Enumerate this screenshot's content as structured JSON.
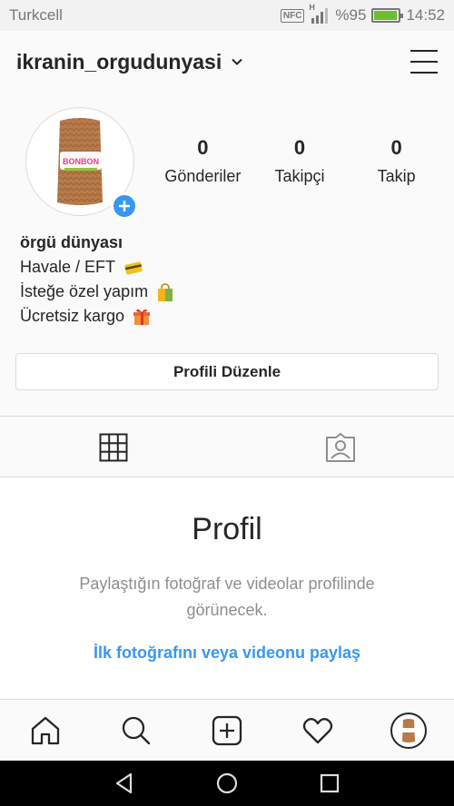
{
  "status_bar": {
    "carrier": "Turkcell",
    "nfc": "NFC",
    "network_type": "H",
    "battery": "%95",
    "battery_level": 0.95,
    "time": "14:52"
  },
  "header": {
    "username": "ikranin_orgudunyasi",
    "icons": [
      "chevron-down-icon",
      "menu-icon"
    ]
  },
  "profile": {
    "avatar_brand_text": "BONBON",
    "stats": [
      {
        "value": "0",
        "label": "Gönderiler"
      },
      {
        "value": "0",
        "label": "Takipçi"
      },
      {
        "value": "0",
        "label": "Takip"
      }
    ],
    "bio": {
      "name": "örgü dünyası",
      "lines": [
        "Havale / EFT",
        "İsteğe özel yapım",
        "Ücretsiz kargo"
      ],
      "line_icons": [
        "credit-card-icon",
        "shopping-bag-icon",
        "gift-icon"
      ]
    },
    "edit_button": "Profili Düzenle"
  },
  "tabs": [
    {
      "name": "grid",
      "icon": "grid-icon",
      "active": true
    },
    {
      "name": "tagged",
      "icon": "tagged-photos-icon",
      "active": false
    }
  ],
  "empty_state": {
    "title": "Profil",
    "text": "Paylaştığın fotoğraf ve videolar profilinde görünecek.",
    "link": "İlk fotoğrafını veya videonu paylaş"
  },
  "bottom_nav": [
    "home-icon",
    "search-icon",
    "add-post-icon",
    "activity-heart-icon",
    "profile-avatar-icon"
  ],
  "android_nav": [
    "back-icon",
    "home-circle-icon",
    "recents-icon"
  ],
  "colors": {
    "accent": "#3897f0",
    "text": "#262626",
    "muted": "#8e8e8e",
    "border": "#dbdbdb",
    "yarn": "#b77a4a"
  }
}
